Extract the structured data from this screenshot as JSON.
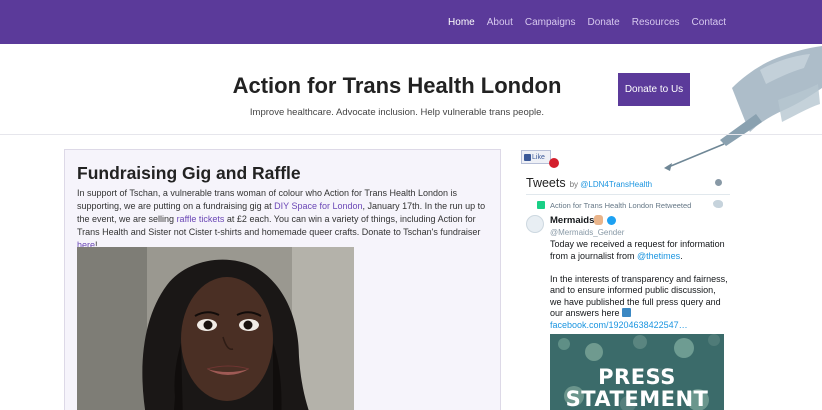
{
  "nav": {
    "items": [
      {
        "label": "Home",
        "active": true
      },
      {
        "label": "About",
        "active": false
      },
      {
        "label": "Campaigns",
        "active": false
      },
      {
        "label": "Donate",
        "active": false
      },
      {
        "label": "Resources",
        "active": false
      },
      {
        "label": "Contact",
        "active": false
      }
    ]
  },
  "header": {
    "title": "Action for Trans Health London",
    "tagline": "Improve healthcare. Advocate inclusion. Help vulnerable trans people.",
    "donate_button": "Donate to Us"
  },
  "post": {
    "title": "Fundraising Gig and Raffle",
    "body_1": "In support of Tschan, a vulnerable trans woman of colour who Action for Trans Health London is supporting, we are putting on a fundraising gig at ",
    "link_1": "DIY Space for London",
    "body_2": ", January 17th. In the run up to the event, we are selling ",
    "link_2": "raffle tickets",
    "body_3": " at £2 each. You can win a variety of things, including Action for Trans Health and Sister not Cister t-shirts and homemade queer crafts. Donate to Tschan's fundraiser ",
    "link_3": "here",
    "body_4": "!"
  },
  "facebook": {
    "like_label": "Like"
  },
  "twitter": {
    "title": "Tweets",
    "by": "by ",
    "handle_link": "@LDN4TransHealth",
    "retweet_note": "Action for Trans Health London Retweeted",
    "author_name": "Mermaids",
    "author_handle": "@Mermaids_Gender",
    "text_1": "Today we received a request for information from a journalist from ",
    "text_link": "@thetimes",
    "text_2": ".",
    "text_3": "In the interests of transparency and fairness, and to ensure informed public discussion, we have published the full press query and our answers here",
    "text_link_2": "facebook.com/19204638422547…",
    "media_text": "PRESS\nSTATEMENT"
  },
  "colors": {
    "brand": "#5b3a9a",
    "link": "#6a46b5",
    "twitter_link": "#1b95e0"
  }
}
